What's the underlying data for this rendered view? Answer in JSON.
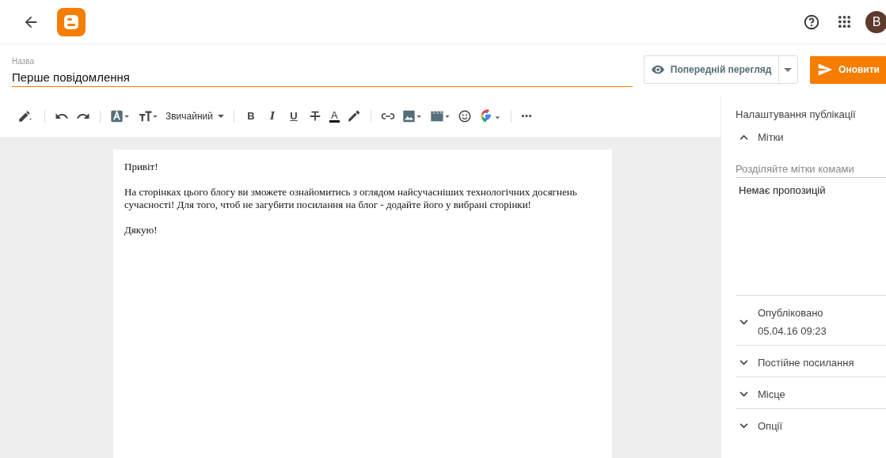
{
  "header": {
    "avatar": "B"
  },
  "title_field": {
    "label": "Назва",
    "value": "Перше повідомлення"
  },
  "actions": {
    "preview": "Попередній перегляд",
    "update": "Оновити"
  },
  "toolbar": {
    "paragraph_style": "Звичайний",
    "format_letters": [
      "B",
      "I",
      "U"
    ],
    "text_color_letter": "A"
  },
  "post": {
    "paragraphs": [
      "Привіт!",
      "На сторінках цього блогу ви зможете ознайомитись з оглядом найсучасніших технологічних досягнень сучасності! Для того, чтоб не загубити посилання на блог - додайте його у вибрані сторінки!",
      "Дякую!"
    ]
  },
  "sidebar": {
    "title": "Налаштування публікації",
    "sections": [
      {
        "kind": "labels",
        "label": "Мітки",
        "expanded": true,
        "placeholder": "Розділяйте мітки комами",
        "note": "Немає пропозицій"
      },
      {
        "kind": "published",
        "label": "Опубліковано",
        "expanded": false,
        "value": "05.04.16 09:23"
      },
      {
        "kind": "plain",
        "label": "Постійне посилання",
        "expanded": false
      },
      {
        "kind": "plain",
        "label": "Місце",
        "expanded": false
      },
      {
        "kind": "plain",
        "label": "Опції",
        "expanded": false
      }
    ]
  }
}
